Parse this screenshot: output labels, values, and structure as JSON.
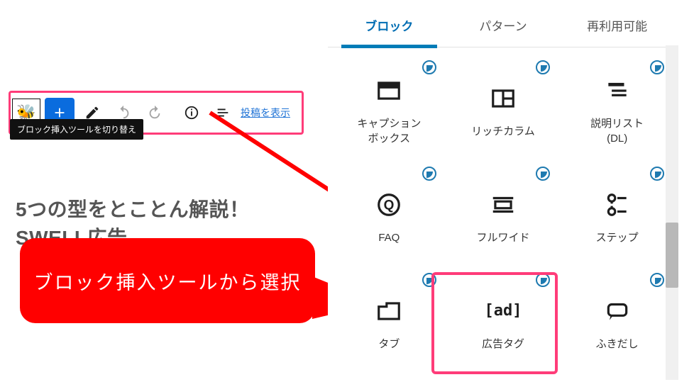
{
  "editor": {
    "logo_emoji": "🐝",
    "view_link": "投稿を表示",
    "tooltip": "ブロック挿入ツールを切り替え",
    "post_title": "5つの型をとことん解説！SWELL広告"
  },
  "callout": {
    "text": "ブロック挿入ツールから選択"
  },
  "inserter": {
    "tabs": {
      "blocks": "ブロック",
      "patterns": "パターン",
      "reusable": "再利用可能"
    },
    "blocks": {
      "caption_box": "キャプション\nボックス",
      "rich_columns": "リッチカラム",
      "desc_list": "説明リスト\n(DL)",
      "faq": "FAQ",
      "full_wide": "フルワイド",
      "step": "ステップ",
      "tab": "タブ",
      "ad_tag": "広告タグ",
      "speech": "ふきだし"
    }
  }
}
